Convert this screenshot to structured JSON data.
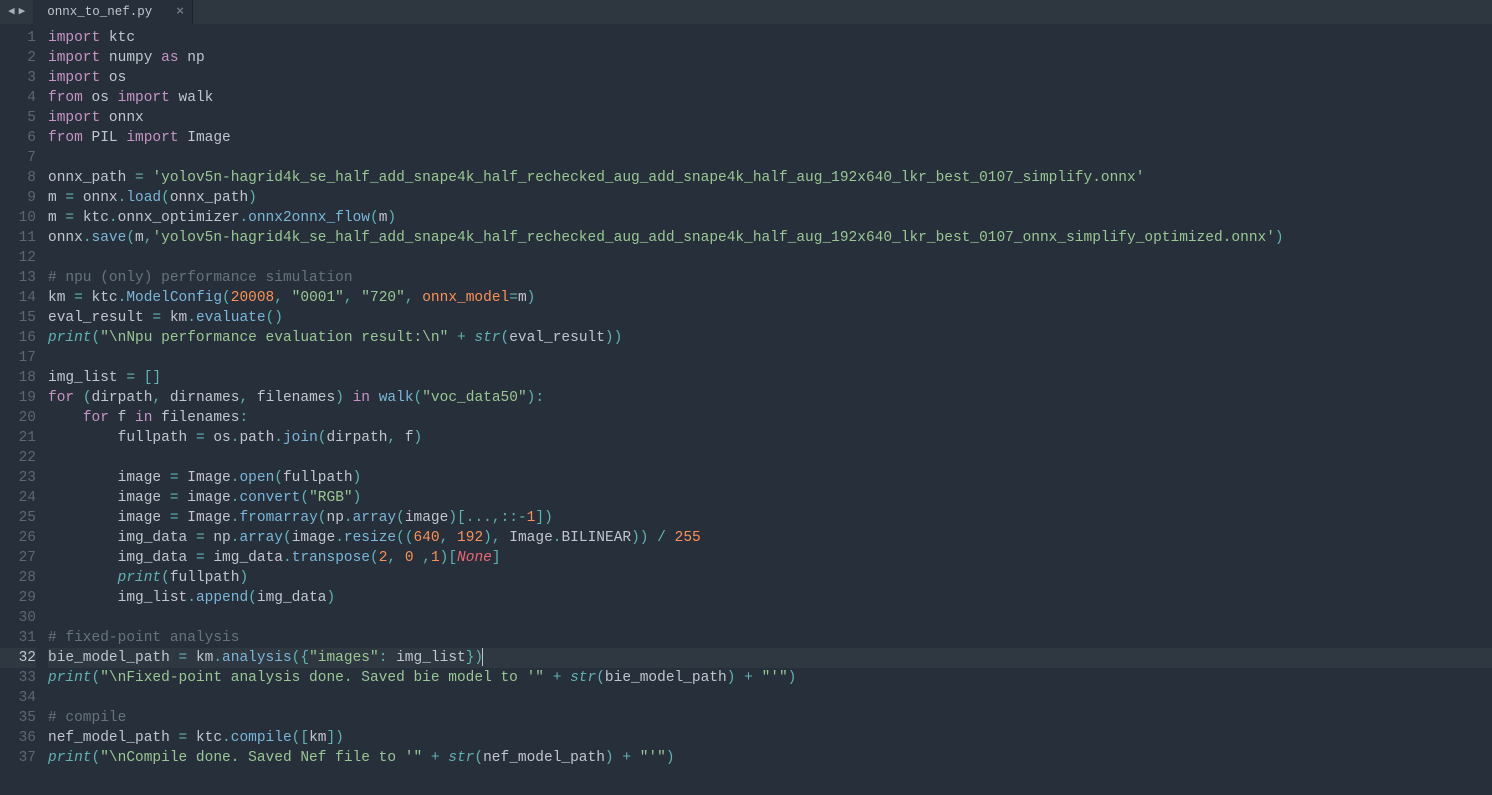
{
  "tab": {
    "filename": "onnx_to_nef.py",
    "close": "×"
  },
  "nav": {
    "back": "◀",
    "forward": "▶"
  },
  "active_line": 32,
  "lines": [
    {
      "n": 1,
      "tokens": [
        [
          "kw",
          "import"
        ],
        [
          "sp",
          " "
        ],
        [
          "name",
          "ktc"
        ]
      ]
    },
    {
      "n": 2,
      "tokens": [
        [
          "kw",
          "import"
        ],
        [
          "sp",
          " "
        ],
        [
          "name",
          "numpy"
        ],
        [
          "sp",
          " "
        ],
        [
          "kw",
          "as"
        ],
        [
          "sp",
          " "
        ],
        [
          "name",
          "np"
        ]
      ]
    },
    {
      "n": 3,
      "tokens": [
        [
          "kw",
          "import"
        ],
        [
          "sp",
          " "
        ],
        [
          "name",
          "os"
        ]
      ]
    },
    {
      "n": 4,
      "tokens": [
        [
          "kw",
          "from"
        ],
        [
          "sp",
          " "
        ],
        [
          "name",
          "os"
        ],
        [
          "sp",
          " "
        ],
        [
          "kw",
          "import"
        ],
        [
          "sp",
          " "
        ],
        [
          "name",
          "walk"
        ]
      ]
    },
    {
      "n": 5,
      "tokens": [
        [
          "kw",
          "import"
        ],
        [
          "sp",
          " "
        ],
        [
          "name",
          "onnx"
        ]
      ]
    },
    {
      "n": 6,
      "tokens": [
        [
          "kw",
          "from"
        ],
        [
          "sp",
          " "
        ],
        [
          "name",
          "PIL"
        ],
        [
          "sp",
          " "
        ],
        [
          "kw",
          "import"
        ],
        [
          "sp",
          " "
        ],
        [
          "name",
          "Image"
        ]
      ]
    },
    {
      "n": 7,
      "tokens": []
    },
    {
      "n": 8,
      "tokens": [
        [
          "name",
          "onnx_path"
        ],
        [
          "sp",
          " "
        ],
        [
          "punc",
          "="
        ],
        [
          "sp",
          " "
        ],
        [
          "str",
          "'yolov5n-hagrid4k_se_half_add_snape4k_half_rechecked_aug_add_snape4k_half_aug_192x640_lkr_best_0107_simplify.onnx'"
        ]
      ]
    },
    {
      "n": 9,
      "tokens": [
        [
          "name",
          "m"
        ],
        [
          "sp",
          " "
        ],
        [
          "punc",
          "="
        ],
        [
          "sp",
          " "
        ],
        [
          "name",
          "onnx"
        ],
        [
          "punc",
          "."
        ],
        [
          "call",
          "load"
        ],
        [
          "punc",
          "("
        ],
        [
          "name",
          "onnx_path"
        ],
        [
          "punc",
          ")"
        ]
      ]
    },
    {
      "n": 10,
      "tokens": [
        [
          "name",
          "m"
        ],
        [
          "sp",
          " "
        ],
        [
          "punc",
          "="
        ],
        [
          "sp",
          " "
        ],
        [
          "name",
          "ktc"
        ],
        [
          "punc",
          "."
        ],
        [
          "name",
          "onnx_optimizer"
        ],
        [
          "punc",
          "."
        ],
        [
          "call",
          "onnx2onnx_flow"
        ],
        [
          "punc",
          "("
        ],
        [
          "name",
          "m"
        ],
        [
          "punc",
          ")"
        ]
      ]
    },
    {
      "n": 11,
      "tokens": [
        [
          "name",
          "onnx"
        ],
        [
          "punc",
          "."
        ],
        [
          "call",
          "save"
        ],
        [
          "punc",
          "("
        ],
        [
          "name",
          "m"
        ],
        [
          "punc",
          ","
        ],
        [
          "str",
          "'yolov5n-hagrid4k_se_half_add_snape4k_half_rechecked_aug_add_snape4k_half_aug_192x640_lkr_best_0107_onnx_simplify_optimized.onnx'"
        ],
        [
          "punc",
          ")"
        ]
      ]
    },
    {
      "n": 12,
      "tokens": []
    },
    {
      "n": 13,
      "tokens": [
        [
          "cm",
          "# npu (only) performance simulation"
        ]
      ]
    },
    {
      "n": 14,
      "tokens": [
        [
          "name",
          "km"
        ],
        [
          "sp",
          " "
        ],
        [
          "punc",
          "="
        ],
        [
          "sp",
          " "
        ],
        [
          "name",
          "ktc"
        ],
        [
          "punc",
          "."
        ],
        [
          "call",
          "ModelConfig"
        ],
        [
          "punc",
          "("
        ],
        [
          "num",
          "20008"
        ],
        [
          "punc",
          ","
        ],
        [
          "sp",
          " "
        ],
        [
          "str",
          "\"0001\""
        ],
        [
          "punc",
          ","
        ],
        [
          "sp",
          " "
        ],
        [
          "str",
          "\"720\""
        ],
        [
          "punc",
          ","
        ],
        [
          "sp",
          " "
        ],
        [
          "kwarg",
          "onnx_model"
        ],
        [
          "punc",
          "="
        ],
        [
          "name",
          "m"
        ],
        [
          "punc",
          ")"
        ]
      ]
    },
    {
      "n": 15,
      "tokens": [
        [
          "name",
          "eval_result"
        ],
        [
          "sp",
          " "
        ],
        [
          "punc",
          "="
        ],
        [
          "sp",
          " "
        ],
        [
          "name",
          "km"
        ],
        [
          "punc",
          "."
        ],
        [
          "call",
          "evaluate"
        ],
        [
          "punc",
          "()"
        ]
      ]
    },
    {
      "n": 16,
      "tokens": [
        [
          "fn",
          "print"
        ],
        [
          "punc",
          "("
        ],
        [
          "str",
          "\"\\nNpu performance evaluation result:\\n\""
        ],
        [
          "sp",
          " "
        ],
        [
          "punc",
          "+"
        ],
        [
          "sp",
          " "
        ],
        [
          "fn",
          "str"
        ],
        [
          "punc",
          "("
        ],
        [
          "name",
          "eval_result"
        ],
        [
          "punc",
          "))"
        ]
      ]
    },
    {
      "n": 17,
      "tokens": []
    },
    {
      "n": 18,
      "tokens": [
        [
          "name",
          "img_list"
        ],
        [
          "sp",
          " "
        ],
        [
          "punc",
          "="
        ],
        [
          "sp",
          " "
        ],
        [
          "punc",
          "[]"
        ]
      ]
    },
    {
      "n": 19,
      "tokens": [
        [
          "kw",
          "for"
        ],
        [
          "sp",
          " "
        ],
        [
          "punc",
          "("
        ],
        [
          "name",
          "dirpath"
        ],
        [
          "punc",
          ","
        ],
        [
          "sp",
          " "
        ],
        [
          "name",
          "dirnames"
        ],
        [
          "punc",
          ","
        ],
        [
          "sp",
          " "
        ],
        [
          "name",
          "filenames"
        ],
        [
          "punc",
          ")"
        ],
        [
          "sp",
          " "
        ],
        [
          "kw",
          "in"
        ],
        [
          "sp",
          " "
        ],
        [
          "call",
          "walk"
        ],
        [
          "punc",
          "("
        ],
        [
          "str",
          "\"voc_data50\""
        ],
        [
          "punc",
          "):"
        ]
      ]
    },
    {
      "n": 20,
      "tokens": [
        [
          "sp",
          "    "
        ],
        [
          "kw",
          "for"
        ],
        [
          "sp",
          " "
        ],
        [
          "name",
          "f"
        ],
        [
          "sp",
          " "
        ],
        [
          "kw",
          "in"
        ],
        [
          "sp",
          " "
        ],
        [
          "name",
          "filenames"
        ],
        [
          "punc",
          ":"
        ]
      ]
    },
    {
      "n": 21,
      "tokens": [
        [
          "sp",
          "        "
        ],
        [
          "name",
          "fullpath"
        ],
        [
          "sp",
          " "
        ],
        [
          "punc",
          "="
        ],
        [
          "sp",
          " "
        ],
        [
          "name",
          "os"
        ],
        [
          "punc",
          "."
        ],
        [
          "name",
          "path"
        ],
        [
          "punc",
          "."
        ],
        [
          "call",
          "join"
        ],
        [
          "punc",
          "("
        ],
        [
          "name",
          "dirpath"
        ],
        [
          "punc",
          ","
        ],
        [
          "sp",
          " "
        ],
        [
          "name",
          "f"
        ],
        [
          "punc",
          ")"
        ]
      ]
    },
    {
      "n": 22,
      "tokens": []
    },
    {
      "n": 23,
      "tokens": [
        [
          "sp",
          "        "
        ],
        [
          "name",
          "image"
        ],
        [
          "sp",
          " "
        ],
        [
          "punc",
          "="
        ],
        [
          "sp",
          " "
        ],
        [
          "name",
          "Image"
        ],
        [
          "punc",
          "."
        ],
        [
          "call",
          "open"
        ],
        [
          "punc",
          "("
        ],
        [
          "name",
          "fullpath"
        ],
        [
          "punc",
          ")"
        ]
      ]
    },
    {
      "n": 24,
      "tokens": [
        [
          "sp",
          "        "
        ],
        [
          "name",
          "image"
        ],
        [
          "sp",
          " "
        ],
        [
          "punc",
          "="
        ],
        [
          "sp",
          " "
        ],
        [
          "name",
          "image"
        ],
        [
          "punc",
          "."
        ],
        [
          "call",
          "convert"
        ],
        [
          "punc",
          "("
        ],
        [
          "str",
          "\"RGB\""
        ],
        [
          "punc",
          ")"
        ]
      ]
    },
    {
      "n": 25,
      "tokens": [
        [
          "sp",
          "        "
        ],
        [
          "name",
          "image"
        ],
        [
          "sp",
          " "
        ],
        [
          "punc",
          "="
        ],
        [
          "sp",
          " "
        ],
        [
          "name",
          "Image"
        ],
        [
          "punc",
          "."
        ],
        [
          "call",
          "fromarray"
        ],
        [
          "punc",
          "("
        ],
        [
          "name",
          "np"
        ],
        [
          "punc",
          "."
        ],
        [
          "call",
          "array"
        ],
        [
          "punc",
          "("
        ],
        [
          "name",
          "image"
        ],
        [
          "punc",
          ")["
        ],
        [
          "punc",
          "..."
        ],
        [
          "punc",
          ","
        ],
        [
          "punc",
          "::"
        ],
        [
          "punc",
          "-"
        ],
        [
          "num",
          "1"
        ],
        [
          "punc",
          "])"
        ]
      ]
    },
    {
      "n": 26,
      "tokens": [
        [
          "sp",
          "        "
        ],
        [
          "name",
          "img_data"
        ],
        [
          "sp",
          " "
        ],
        [
          "punc",
          "="
        ],
        [
          "sp",
          " "
        ],
        [
          "name",
          "np"
        ],
        [
          "punc",
          "."
        ],
        [
          "call",
          "array"
        ],
        [
          "punc",
          "("
        ],
        [
          "name",
          "image"
        ],
        [
          "punc",
          "."
        ],
        [
          "call",
          "resize"
        ],
        [
          "punc",
          "(("
        ],
        [
          "num",
          "640"
        ],
        [
          "punc",
          ","
        ],
        [
          "sp",
          " "
        ],
        [
          "num",
          "192"
        ],
        [
          "punc",
          "),"
        ],
        [
          "sp",
          " "
        ],
        [
          "name",
          "Image"
        ],
        [
          "punc",
          "."
        ],
        [
          "name",
          "BILINEAR"
        ],
        [
          "punc",
          "))"
        ],
        [
          "sp",
          " "
        ],
        [
          "punc",
          "/"
        ],
        [
          "sp",
          " "
        ],
        [
          "num",
          "255"
        ]
      ]
    },
    {
      "n": 27,
      "tokens": [
        [
          "sp",
          "        "
        ],
        [
          "name",
          "img_data"
        ],
        [
          "sp",
          " "
        ],
        [
          "punc",
          "="
        ],
        [
          "sp",
          " "
        ],
        [
          "name",
          "img_data"
        ],
        [
          "punc",
          "."
        ],
        [
          "call",
          "transpose"
        ],
        [
          "punc",
          "("
        ],
        [
          "num",
          "2"
        ],
        [
          "punc",
          ","
        ],
        [
          "sp",
          " "
        ],
        [
          "num",
          "0"
        ],
        [
          "sp",
          " "
        ],
        [
          "punc",
          ","
        ],
        [
          "num",
          "1"
        ],
        [
          "punc",
          ")["
        ],
        [
          "const",
          "None"
        ],
        [
          "punc",
          "]"
        ]
      ]
    },
    {
      "n": 28,
      "tokens": [
        [
          "sp",
          "        "
        ],
        [
          "fn",
          "print"
        ],
        [
          "punc",
          "("
        ],
        [
          "name",
          "fullpath"
        ],
        [
          "punc",
          ")"
        ]
      ]
    },
    {
      "n": 29,
      "tokens": [
        [
          "sp",
          "        "
        ],
        [
          "name",
          "img_list"
        ],
        [
          "punc",
          "."
        ],
        [
          "call",
          "append"
        ],
        [
          "punc",
          "("
        ],
        [
          "name",
          "img_data"
        ],
        [
          "punc",
          ")"
        ]
      ]
    },
    {
      "n": 30,
      "tokens": []
    },
    {
      "n": 31,
      "tokens": [
        [
          "cm",
          "# fixed-point analysis"
        ]
      ]
    },
    {
      "n": 32,
      "tokens": [
        [
          "name",
          "bie_model_path"
        ],
        [
          "sp",
          " "
        ],
        [
          "punc",
          "="
        ],
        [
          "sp",
          " "
        ],
        [
          "name",
          "km"
        ],
        [
          "punc",
          "."
        ],
        [
          "call",
          "analysis"
        ],
        [
          "punc",
          "({"
        ],
        [
          "str",
          "\"images\""
        ],
        [
          "punc",
          ":"
        ],
        [
          "sp",
          " "
        ],
        [
          "name",
          "img_list"
        ],
        [
          "punc",
          "})"
        ]
      ]
    },
    {
      "n": 33,
      "tokens": [
        [
          "fn",
          "print"
        ],
        [
          "punc",
          "("
        ],
        [
          "str",
          "\"\\nFixed-point analysis done. Saved bie model to '\""
        ],
        [
          "sp",
          " "
        ],
        [
          "punc",
          "+"
        ],
        [
          "sp",
          " "
        ],
        [
          "fn",
          "str"
        ],
        [
          "punc",
          "("
        ],
        [
          "name",
          "bie_model_path"
        ],
        [
          "punc",
          ")"
        ],
        [
          "sp",
          " "
        ],
        [
          "punc",
          "+"
        ],
        [
          "sp",
          " "
        ],
        [
          "str",
          "\"'\""
        ],
        [
          "punc",
          ")"
        ]
      ]
    },
    {
      "n": 34,
      "tokens": []
    },
    {
      "n": 35,
      "tokens": [
        [
          "cm",
          "# compile"
        ]
      ]
    },
    {
      "n": 36,
      "tokens": [
        [
          "name",
          "nef_model_path"
        ],
        [
          "sp",
          " "
        ],
        [
          "punc",
          "="
        ],
        [
          "sp",
          " "
        ],
        [
          "name",
          "ktc"
        ],
        [
          "punc",
          "."
        ],
        [
          "call",
          "compile"
        ],
        [
          "punc",
          "(["
        ],
        [
          "name",
          "km"
        ],
        [
          "punc",
          "])"
        ]
      ]
    },
    {
      "n": 37,
      "tokens": [
        [
          "fn",
          "print"
        ],
        [
          "punc",
          "("
        ],
        [
          "str",
          "\"\\nCompile done. Saved Nef file to '\""
        ],
        [
          "sp",
          " "
        ],
        [
          "punc",
          "+"
        ],
        [
          "sp",
          " "
        ],
        [
          "fn",
          "str"
        ],
        [
          "punc",
          "("
        ],
        [
          "name",
          "nef_model_path"
        ],
        [
          "punc",
          ")"
        ],
        [
          "sp",
          " "
        ],
        [
          "punc",
          "+"
        ],
        [
          "sp",
          " "
        ],
        [
          "str",
          "\"'\""
        ],
        [
          "punc",
          ")"
        ]
      ]
    }
  ]
}
